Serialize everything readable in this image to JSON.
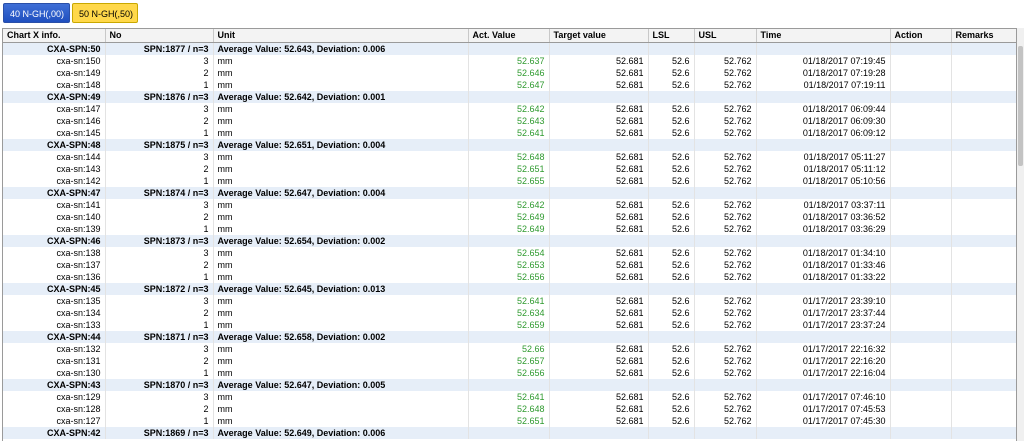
{
  "tabs": [
    {
      "label": "40 N-GH(,00)"
    },
    {
      "label": "50 N-GH(,50)"
    }
  ],
  "columns": [
    "Chart X info.",
    "No",
    "Unit",
    "Act. Value",
    "Target value",
    "LSL",
    "USL",
    "Time",
    "Action",
    "Remarks"
  ],
  "groups": [
    {
      "info": "CXA-SPN:50",
      "no": "SPN:1877 / n=3",
      "unit": "Average Value: 52.643, Deviation: 0.006",
      "rows": [
        {
          "info": "cxa-sn:150",
          "no": "3",
          "unit": "mm",
          "act": "52.637",
          "target": "52.681",
          "lsl": "52.6",
          "usl": "52.762",
          "time": "01/18/2017 07:19:45"
        },
        {
          "info": "cxa-sn:149",
          "no": "2",
          "unit": "mm",
          "act": "52.646",
          "target": "52.681",
          "lsl": "52.6",
          "usl": "52.762",
          "time": "01/18/2017 07:19:28"
        },
        {
          "info": "cxa-sn:148",
          "no": "1",
          "unit": "mm",
          "act": "52.647",
          "target": "52.681",
          "lsl": "52.6",
          "usl": "52.762",
          "time": "01/18/2017 07:19:11"
        }
      ]
    },
    {
      "info": "CXA-SPN:49",
      "no": "SPN:1876 / n=3",
      "unit": "Average Value: 52.642, Deviation: 0.001",
      "rows": [
        {
          "info": "cxa-sn:147",
          "no": "3",
          "unit": "mm",
          "act": "52.642",
          "target": "52.681",
          "lsl": "52.6",
          "usl": "52.762",
          "time": "01/18/2017 06:09:44"
        },
        {
          "info": "cxa-sn:146",
          "no": "2",
          "unit": "mm",
          "act": "52.643",
          "target": "52.681",
          "lsl": "52.6",
          "usl": "52.762",
          "time": "01/18/2017 06:09:30"
        },
        {
          "info": "cxa-sn:145",
          "no": "1",
          "unit": "mm",
          "act": "52.641",
          "target": "52.681",
          "lsl": "52.6",
          "usl": "52.762",
          "time": "01/18/2017 06:09:12"
        }
      ]
    },
    {
      "info": "CXA-SPN:48",
      "no": "SPN:1875 / n=3",
      "unit": "Average Value: 52.651, Deviation: 0.004",
      "rows": [
        {
          "info": "cxa-sn:144",
          "no": "3",
          "unit": "mm",
          "act": "52.648",
          "target": "52.681",
          "lsl": "52.6",
          "usl": "52.762",
          "time": "01/18/2017 05:11:27"
        },
        {
          "info": "cxa-sn:143",
          "no": "2",
          "unit": "mm",
          "act": "52.651",
          "target": "52.681",
          "lsl": "52.6",
          "usl": "52.762",
          "time": "01/18/2017 05:11:12"
        },
        {
          "info": "cxa-sn:142",
          "no": "1",
          "unit": "mm",
          "act": "52.655",
          "target": "52.681",
          "lsl": "52.6",
          "usl": "52.762",
          "time": "01/18/2017 05:10:56"
        }
      ]
    },
    {
      "info": "CXA-SPN:47",
      "no": "SPN:1874 / n=3",
      "unit": "Average Value: 52.647, Deviation: 0.004",
      "rows": [
        {
          "info": "cxa-sn:141",
          "no": "3",
          "unit": "mm",
          "act": "52.642",
          "target": "52.681",
          "lsl": "52.6",
          "usl": "52.762",
          "time": "01/18/2017 03:37:11"
        },
        {
          "info": "cxa-sn:140",
          "no": "2",
          "unit": "mm",
          "act": "52.649",
          "target": "52.681",
          "lsl": "52.6",
          "usl": "52.762",
          "time": "01/18/2017 03:36:52"
        },
        {
          "info": "cxa-sn:139",
          "no": "1",
          "unit": "mm",
          "act": "52.649",
          "target": "52.681",
          "lsl": "52.6",
          "usl": "52.762",
          "time": "01/18/2017 03:36:29"
        }
      ]
    },
    {
      "info": "CXA-SPN:46",
      "no": "SPN:1873 / n=3",
      "unit": "Average Value: 52.654, Deviation: 0.002",
      "rows": [
        {
          "info": "cxa-sn:138",
          "no": "3",
          "unit": "mm",
          "act": "52.654",
          "target": "52.681",
          "lsl": "52.6",
          "usl": "52.762",
          "time": "01/18/2017 01:34:10"
        },
        {
          "info": "cxa-sn:137",
          "no": "2",
          "unit": "mm",
          "act": "52.653",
          "target": "52.681",
          "lsl": "52.6",
          "usl": "52.762",
          "time": "01/18/2017 01:33:46"
        },
        {
          "info": "cxa-sn:136",
          "no": "1",
          "unit": "mm",
          "act": "52.656",
          "target": "52.681",
          "lsl": "52.6",
          "usl": "52.762",
          "time": "01/18/2017 01:33:22"
        }
      ]
    },
    {
      "info": "CXA-SPN:45",
      "no": "SPN:1872 / n=3",
      "unit": "Average Value: 52.645, Deviation: 0.013",
      "rows": [
        {
          "info": "cxa-sn:135",
          "no": "3",
          "unit": "mm",
          "act": "52.641",
          "target": "52.681",
          "lsl": "52.6",
          "usl": "52.762",
          "time": "01/17/2017 23:39:10"
        },
        {
          "info": "cxa-sn:134",
          "no": "2",
          "unit": "mm",
          "act": "52.634",
          "target": "52.681",
          "lsl": "52.6",
          "usl": "52.762",
          "time": "01/17/2017 23:37:44"
        },
        {
          "info": "cxa-sn:133",
          "no": "1",
          "unit": "mm",
          "act": "52.659",
          "target": "52.681",
          "lsl": "52.6",
          "usl": "52.762",
          "time": "01/17/2017 23:37:24"
        }
      ]
    },
    {
      "info": "CXA-SPN:44",
      "no": "SPN:1871 / n=3",
      "unit": "Average Value: 52.658, Deviation: 0.002",
      "rows": [
        {
          "info": "cxa-sn:132",
          "no": "3",
          "unit": "mm",
          "act": "52.66",
          "target": "52.681",
          "lsl": "52.6",
          "usl": "52.762",
          "time": "01/17/2017 22:16:32"
        },
        {
          "info": "cxa-sn:131",
          "no": "2",
          "unit": "mm",
          "act": "52.657",
          "target": "52.681",
          "lsl": "52.6",
          "usl": "52.762",
          "time": "01/17/2017 22:16:20"
        },
        {
          "info": "cxa-sn:130",
          "no": "1",
          "unit": "mm",
          "act": "52.656",
          "target": "52.681",
          "lsl": "52.6",
          "usl": "52.762",
          "time": "01/17/2017 22:16:04"
        }
      ]
    },
    {
      "info": "CXA-SPN:43",
      "no": "SPN:1870 / n=3",
      "unit": "Average Value: 52.647, Deviation: 0.005",
      "rows": [
        {
          "info": "cxa-sn:129",
          "no": "3",
          "unit": "mm",
          "act": "52.641",
          "target": "52.681",
          "lsl": "52.6",
          "usl": "52.762",
          "time": "01/17/2017 07:46:10"
        },
        {
          "info": "cxa-sn:128",
          "no": "2",
          "unit": "mm",
          "act": "52.648",
          "target": "52.681",
          "lsl": "52.6",
          "usl": "52.762",
          "time": "01/17/2017 07:45:53"
        },
        {
          "info": "cxa-sn:127",
          "no": "1",
          "unit": "mm",
          "act": "52.651",
          "target": "52.681",
          "lsl": "52.6",
          "usl": "52.762",
          "time": "01/17/2017 07:45:30"
        }
      ]
    },
    {
      "info": "CXA-SPN:42",
      "no": "SPN:1869 / n=3",
      "unit": "Average Value: 52.649, Deviation: 0.006",
      "rows": []
    }
  ]
}
